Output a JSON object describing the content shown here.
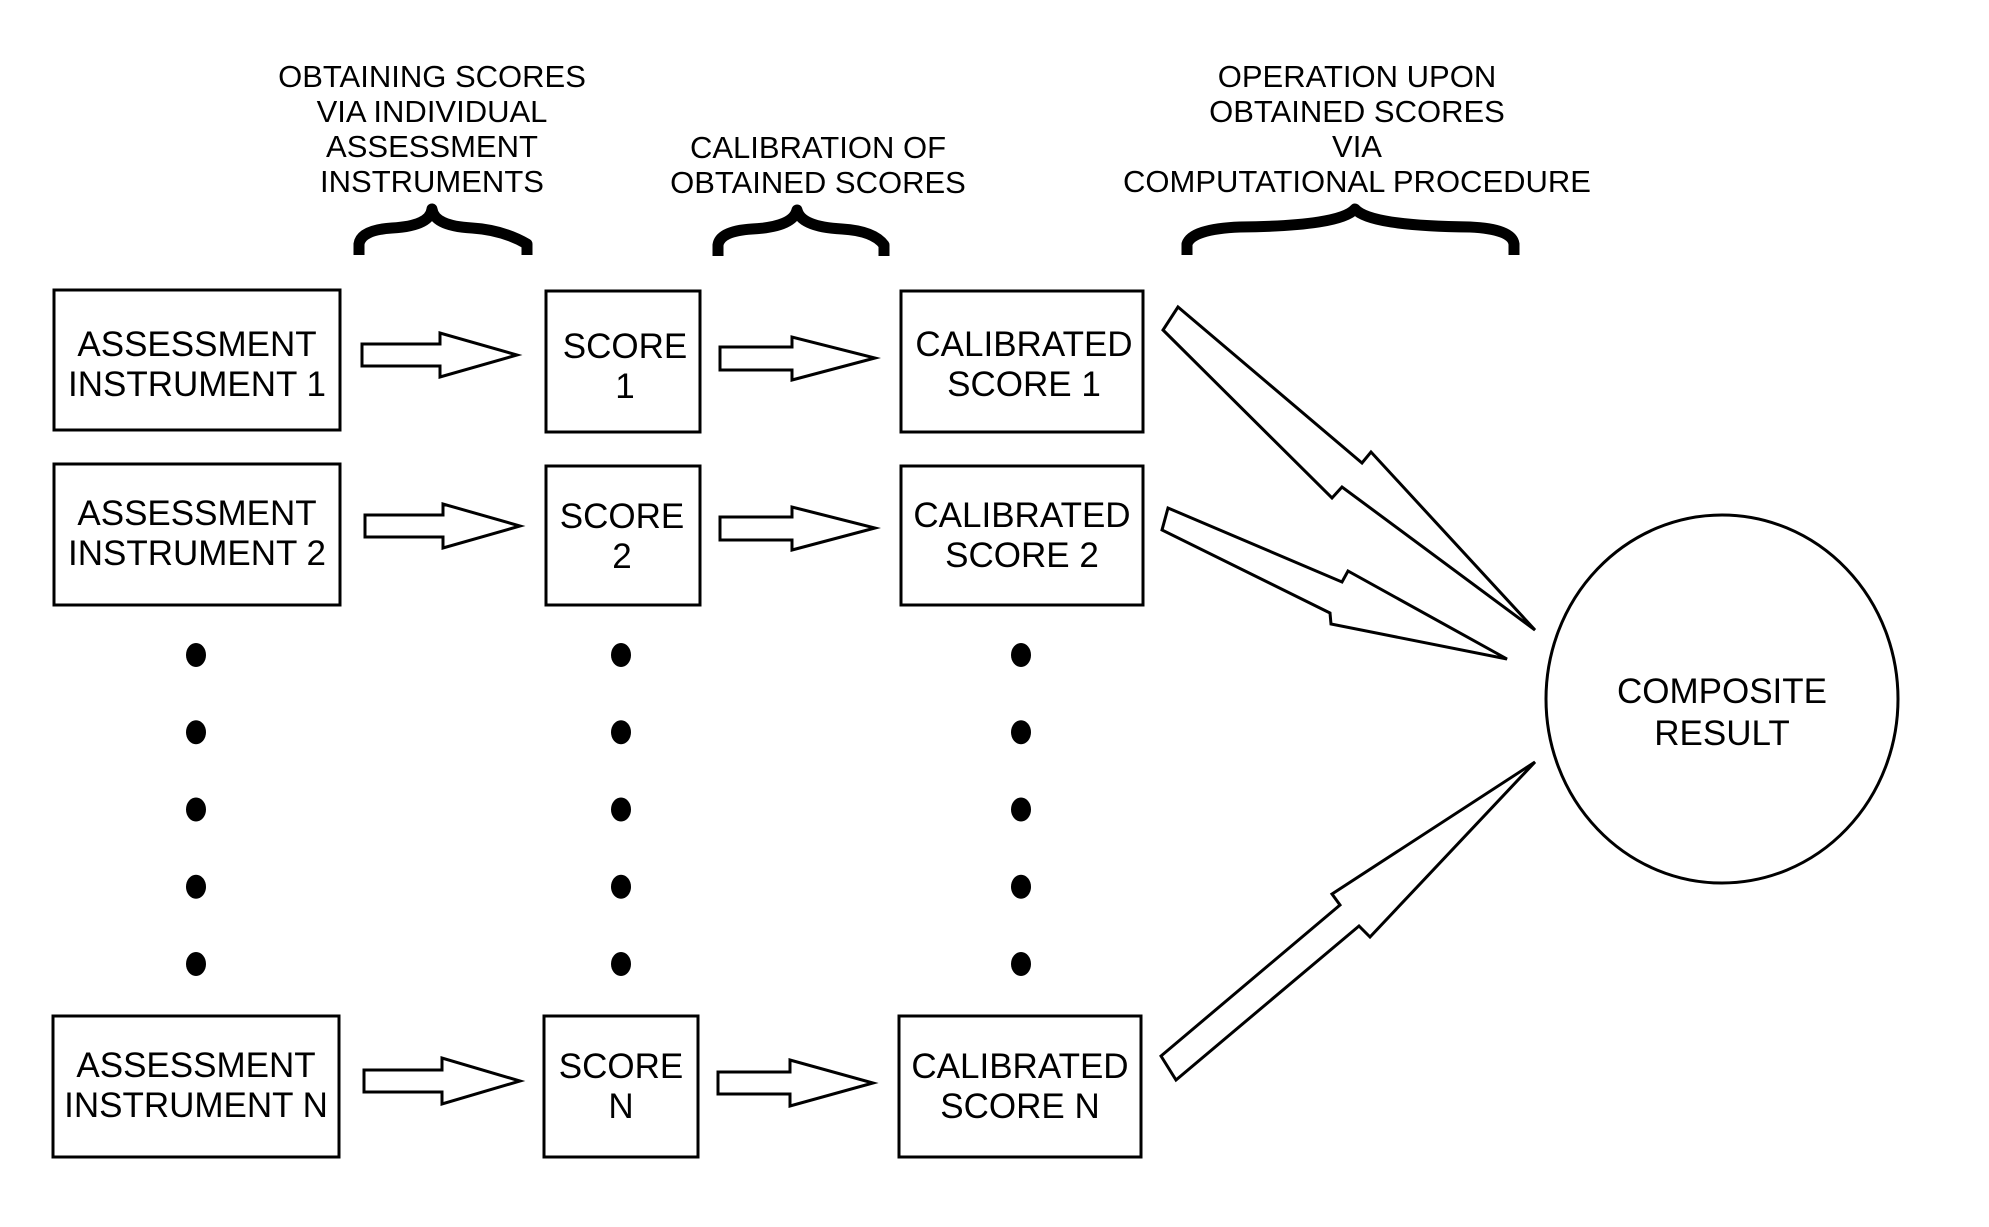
{
  "headers": {
    "obtaining": [
      "OBTAINING SCORES",
      "VIA INDIVIDUAL",
      "ASSESSMENT",
      "INSTRUMENTS"
    ],
    "calibration": [
      "CALIBRATION OF",
      "OBTAINED SCORES"
    ],
    "operation": [
      "OPERATION UPON",
      "OBTAINED SCORES",
      "VIA",
      "COMPUTATIONAL PROCEDURE"
    ]
  },
  "rows": [
    {
      "instrument": [
        "ASSESSMENT",
        "INSTRUMENT 1"
      ],
      "score": [
        "SCORE",
        "1"
      ],
      "calibrated": [
        "CALIBRATED",
        "SCORE 1"
      ]
    },
    {
      "instrument": [
        "ASSESSMENT",
        "INSTRUMENT 2"
      ],
      "score": [
        "SCORE",
        "2"
      ],
      "calibrated": [
        "CALIBRATED",
        "SCORE 2"
      ]
    },
    {
      "instrument": [
        "ASSESSMENT",
        "INSTRUMENT N"
      ],
      "score": [
        "SCORE",
        "N"
      ],
      "calibrated": [
        "CALIBRATED",
        "SCORE N"
      ]
    }
  ],
  "ellipsis_dots_per_column": 5,
  "result": [
    "COMPOSITE",
    "RESULT"
  ]
}
